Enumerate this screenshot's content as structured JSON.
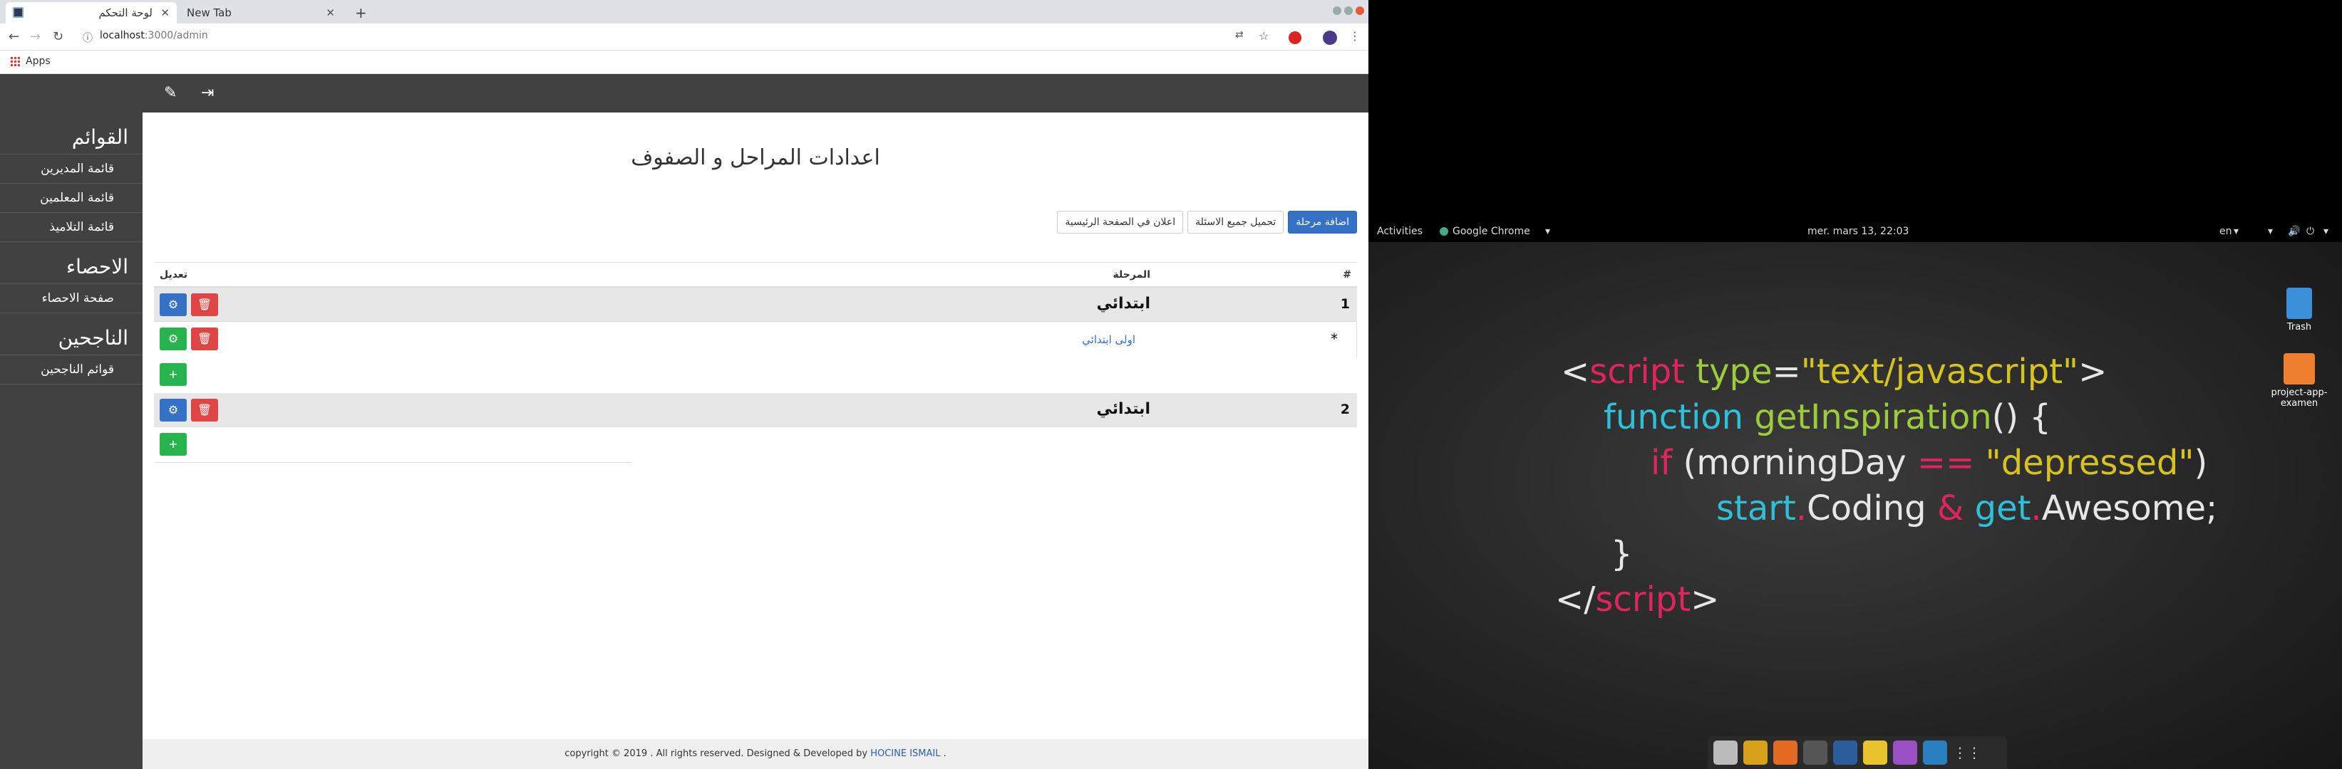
{
  "browser": {
    "tabs": [
      {
        "label": "لوحة التحكم"
      },
      {
        "label": "New Tab"
      }
    ],
    "address": {
      "host": "localhost",
      "path": ":3000/admin"
    },
    "bookmarks": {
      "apps_label": "Apps"
    }
  },
  "sidebar": {
    "sections": [
      {
        "title": "القوائم",
        "items": [
          "قائمة المديرين",
          "قائمة المعلمين",
          "قائمة التلاميذ"
        ]
      },
      {
        "title": "الاحصاء",
        "items": [
          "صفحة الاحصاء"
        ]
      },
      {
        "title": "الناجحين",
        "items": [
          "قوائم الناجحين"
        ]
      }
    ]
  },
  "main": {
    "title": "اعدادات المراحل و الصفوف",
    "buttons": {
      "add_stage": "اضافة مرحلة",
      "load_questions": "تحميل جميع الاسئلة",
      "home_ad": "اعلان في الصفحة الرئيسية"
    },
    "table": {
      "headers": {
        "num": "#",
        "stage": "المرحلة",
        "edit": "تعديل"
      },
      "rows": [
        {
          "num": "1",
          "stage": "ابتدائي",
          "sub": {
            "bullet": "*",
            "label": "اولى ابتدائي"
          }
        },
        {
          "num": "2",
          "stage": "ابتدائي"
        }
      ]
    }
  },
  "footer": {
    "text": "copyright © 2019 . All rights reserved. Designed & Developed by",
    "author": "HOCINE ISMAIL",
    "end": "."
  },
  "desktop": {
    "topbar": {
      "activities": "Activities",
      "app": "Google Chrome",
      "clock": "mer. mars 13, 22:03",
      "lang": "en"
    },
    "icons": {
      "trash": "Trash",
      "folder": "project-app-examen"
    },
    "wallpaper": {
      "l1a": "<",
      "l1b": "script",
      "l1c": " ",
      "l1d": "type",
      "l1e": "=",
      "l1f": "\"text/javascript\"",
      "l1g": ">",
      "l2a": "function",
      "l2b": " ",
      "l2c": "getInspiration",
      "l2d": "() {",
      "l3a": "if",
      "l3b": " (morningDay ",
      "l3c": "==",
      "l3d": " ",
      "l3e": "\"depressed\"",
      "l3f": ")",
      "l4a": "start",
      "l4b": ".",
      "l4c": "Coding",
      "l4d": " & ",
      "l4e": "get",
      "l4f": ".",
      "l4g": "Awesome;",
      "l5": "}",
      "l6a": "</",
      "l6b": "script",
      "l6c": ">"
    }
  },
  "colors": {
    "primary": "#3572c6",
    "danger": "#e04545",
    "success": "#27b34e",
    "sidebar": "#414141"
  }
}
